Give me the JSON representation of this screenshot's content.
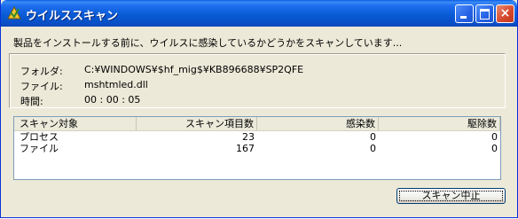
{
  "window": {
    "title": "ウイルススキャン",
    "icon": "antivirus-scan-icon",
    "controls": {
      "minimize": "minimize-icon",
      "maximize": "maximize-icon",
      "close": "×"
    }
  },
  "message": "製品をインストールする前に、ウイルスに感染しているかどうかをスキャンしています...",
  "info": {
    "folder_label": "フォルダ:",
    "folder_value": "C:¥WINDOWS¥$hf_mig$¥KB896688¥SP2QFE",
    "file_label": "ファイル:",
    "file_value": "mshtmled.dll",
    "time_label": "時間:",
    "time_value": "00 : 00 : 05"
  },
  "table": {
    "columns": [
      "スキャン対象",
      "スキャン項目数",
      "感染数",
      "駆除数"
    ],
    "rows": [
      [
        "プロセス",
        "23",
        "0",
        "0"
      ],
      [
        "ファイル",
        "167",
        "0",
        "0"
      ]
    ]
  },
  "buttons": {
    "stop_scan": "スキャン中止"
  },
  "colors": {
    "title_bar": "#0a5bd6",
    "dialog_bg": "#ece9d8",
    "list_border": "#7f9db9"
  }
}
